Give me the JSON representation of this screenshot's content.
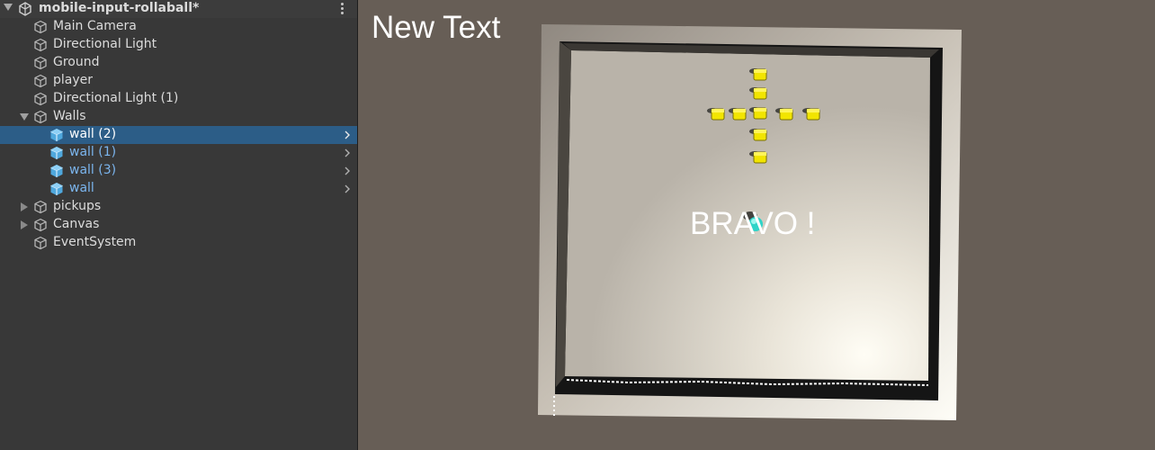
{
  "hierarchy": {
    "scene_name": "mobile-input-rollaball*",
    "items": [
      {
        "label": "Main Camera"
      },
      {
        "label": "Directional Light"
      },
      {
        "label": "Ground"
      },
      {
        "label": "player"
      },
      {
        "label": "Directional Light (1)"
      },
      {
        "label": "Walls"
      },
      {
        "label": "wall (2)"
      },
      {
        "label": "wall (1)"
      },
      {
        "label": "wall (3)"
      },
      {
        "label": "wall"
      },
      {
        "label": "pickups"
      },
      {
        "label": "Canvas"
      },
      {
        "label": "EventSystem"
      }
    ]
  },
  "game": {
    "hud_text": "New Text",
    "win_text": "BRAVO !"
  },
  "colors": {
    "selection": "#2c5d87",
    "prefab_text": "#7bb5ee",
    "prefab_icon": "#4fa8dd",
    "pickup": "#f2e500",
    "player": "#2fd4c8",
    "background": "#675e56"
  }
}
